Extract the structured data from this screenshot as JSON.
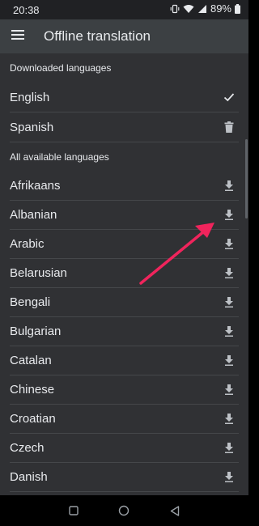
{
  "status_bar": {
    "time": "20:38",
    "battery": "89%",
    "icons": [
      "vibrate-icon",
      "wifi-icon",
      "signal-icon",
      "battery-icon"
    ]
  },
  "app_bar": {
    "title": "Offline translation",
    "menu_icon": "menu-icon"
  },
  "downloaded": {
    "header": "Downloaded languages",
    "items": [
      {
        "label": "English",
        "icon": "check-icon"
      },
      {
        "label": "Spanish",
        "icon": "trash-icon"
      }
    ]
  },
  "available": {
    "header": "All available languages",
    "items": [
      {
        "label": "Afrikaans",
        "icon": "download-icon"
      },
      {
        "label": "Albanian",
        "icon": "download-icon"
      },
      {
        "label": "Arabic",
        "icon": "download-icon"
      },
      {
        "label": "Belarusian",
        "icon": "download-icon"
      },
      {
        "label": "Bengali",
        "icon": "download-icon"
      },
      {
        "label": "Bulgarian",
        "icon": "download-icon"
      },
      {
        "label": "Catalan",
        "icon": "download-icon"
      },
      {
        "label": "Chinese",
        "icon": "download-icon"
      },
      {
        "label": "Croatian",
        "icon": "download-icon"
      },
      {
        "label": "Czech",
        "icon": "download-icon"
      },
      {
        "label": "Danish",
        "icon": "download-icon"
      }
    ]
  },
  "nav_bar": {
    "icons": [
      "recents-icon",
      "home-icon",
      "back-icon"
    ]
  },
  "colors": {
    "background": "#303134",
    "app_bar": "#3c4043",
    "text": "#e8eaed",
    "icon": "#bdc1c6",
    "divider": "#45474a",
    "annotation_arrow": "#f0245c"
  }
}
